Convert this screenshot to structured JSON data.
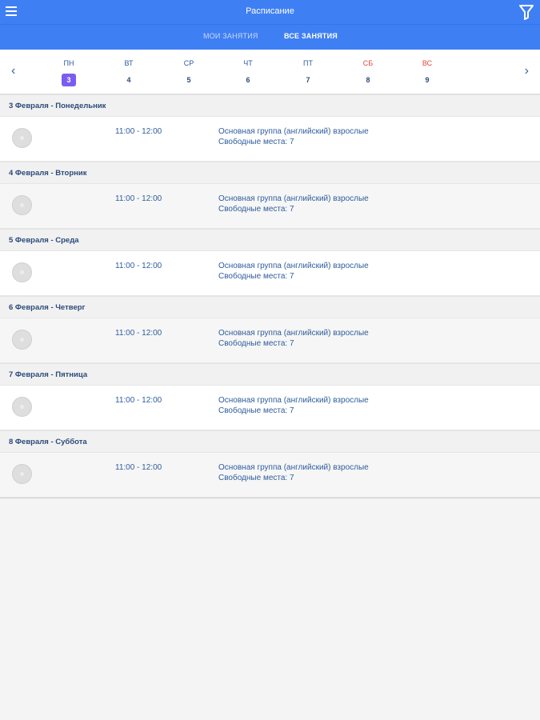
{
  "header": {
    "title": "Расписание",
    "menu_icon": "hamburger-menu-icon",
    "filter_icon": "funnel-filter-icon",
    "accent_color": "#3f7ff4"
  },
  "tabs": [
    {
      "label": "МОИ ЗАНЯТИЯ",
      "active": false
    },
    {
      "label": "ВСЕ ЗАНЯТИЯ",
      "active": true
    }
  ],
  "week": {
    "prev_icon": "chevron-left-icon",
    "next_icon": "chevron-right-icon",
    "days": [
      {
        "dow": "ПН",
        "num": "3",
        "selected": true,
        "weekend": false
      },
      {
        "dow": "ВТ",
        "num": "4",
        "selected": false,
        "weekend": false
      },
      {
        "dow": "СР",
        "num": "5",
        "selected": false,
        "weekend": false
      },
      {
        "dow": "ЧТ",
        "num": "6",
        "selected": false,
        "weekend": false
      },
      {
        "dow": "ПТ",
        "num": "7",
        "selected": false,
        "weekend": false
      },
      {
        "dow": "СБ",
        "num": "8",
        "selected": false,
        "weekend": true
      },
      {
        "dow": "ВС",
        "num": "9",
        "selected": false,
        "weekend": true
      }
    ],
    "selected_color": "#7b5cf0",
    "weekend_color": "#e2453a"
  },
  "schedule": [
    {
      "header": "3 Февраля - Понедельник",
      "time": "11:00 - 12:00",
      "group": "Основная группа (английский) взрослые",
      "seats": "Свободные места: 7"
    },
    {
      "header": "4 Февраля - Вторник",
      "time": "11:00 - 12:00",
      "group": "Основная группа (английский) взрослые",
      "seats": "Свободные места: 7"
    },
    {
      "header": "5 Февраля - Среда",
      "time": "11:00 - 12:00",
      "group": "Основная группа (английский) взрослые",
      "seats": "Свободные места: 7"
    },
    {
      "header": "6 Февраля - Четверг",
      "time": "11:00 - 12:00",
      "group": "Основная группа (английский) взрослые",
      "seats": "Свободные места: 7"
    },
    {
      "header": "7 Февраля - Пятница",
      "time": "11:00 - 12:00",
      "group": "Основная группа (английский) взрослые",
      "seats": "Свободные места: 7"
    },
    {
      "header": "8 Февраля - Суббота",
      "time": "11:00 - 12:00",
      "group": "Основная группа (английский) взрослые",
      "seats": "Свободные места: 7"
    }
  ]
}
